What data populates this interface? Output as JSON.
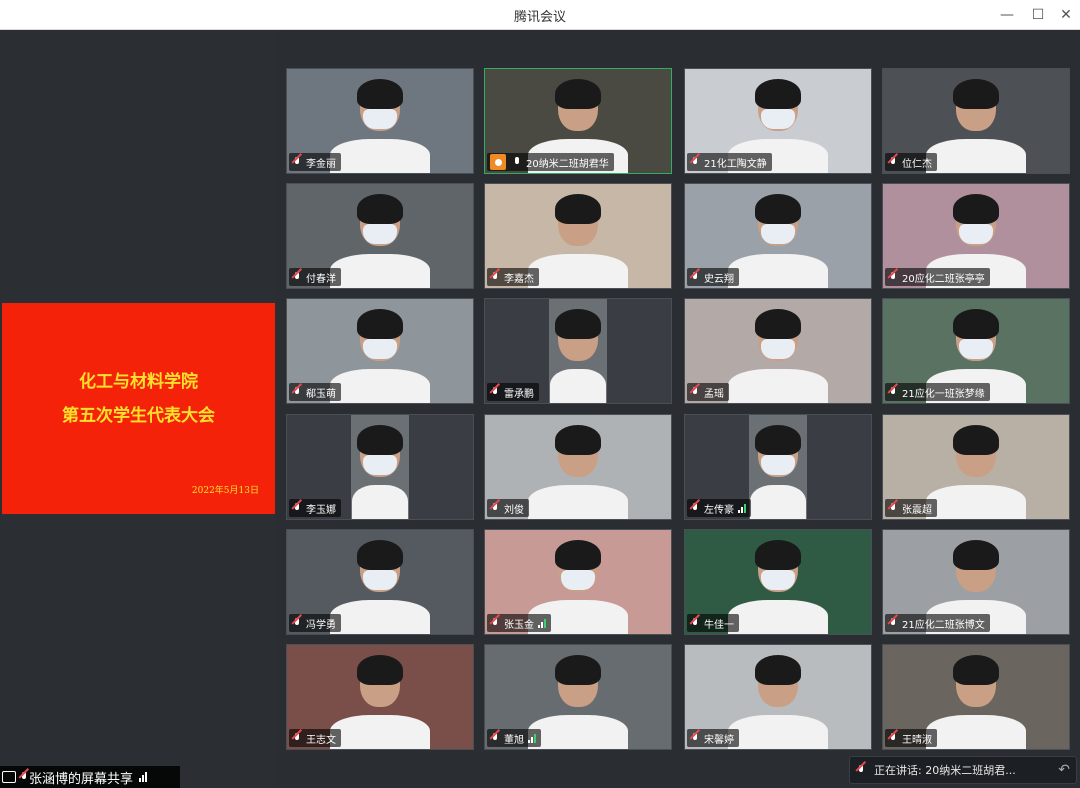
{
  "window": {
    "title": "腾讯会议",
    "minimize": "—",
    "maximize": "☐",
    "close": "✕"
  },
  "slide": {
    "line1": "化工与材料学院",
    "line2": "第五次学生代表大会",
    "date": "2022年5月13日"
  },
  "screen_share": {
    "label": "张涵博的屏幕共享"
  },
  "speaking": {
    "label": "正在讲话: 20纳米二班胡君...",
    "arrow": "↶"
  },
  "participants": [
    {
      "name": "李金丽",
      "bg": "#6e7680",
      "mask": true
    },
    {
      "name": "20纳米二班胡君华",
      "bg": "#4a4a42",
      "mask": false,
      "host": true,
      "mic_on": true,
      "active": true
    },
    {
      "name": "21化工陶文静",
      "bg": "#c9cdd1",
      "mask": true
    },
    {
      "name": "位仁杰",
      "bg": "#4d5055",
      "mask": false
    },
    {
      "name": "付春洋",
      "bg": "#5f6569",
      "mask": true
    },
    {
      "name": "李嘉杰",
      "bg": "#c7b7a6",
      "mask": false
    },
    {
      "name": "史云翔",
      "bg": "#9aa1a8",
      "mask": true
    },
    {
      "name": "20应化二班张亭亭",
      "bg": "#b0909d",
      "mask": true
    },
    {
      "name": "郗玉萌",
      "bg": "#8e969c",
      "mask": true
    },
    {
      "name": "雷承鹏",
      "bg": "#3a3e44",
      "mask": false,
      "narrow": true
    },
    {
      "name": "孟瑶",
      "bg": "#b3a9a6",
      "mask": true
    },
    {
      "name": "21应化一班张梦缘",
      "bg": "#5a7262",
      "mask": true
    },
    {
      "name": "李玉娜",
      "bg": "#3a3e44",
      "mask": true,
      "narrow": true
    },
    {
      "name": "刘俊",
      "bg": "#aeb2b5",
      "mask": false
    },
    {
      "name": "左传豪",
      "bg": "#3a3e44",
      "mask": true,
      "narrow": true,
      "bars": true
    },
    {
      "name": "张震超",
      "bg": "#b8b0a4",
      "mask": false
    },
    {
      "name": "冯学勇",
      "bg": "#545a60",
      "mask": true
    },
    {
      "name": "张玉金",
      "bg": "#c89a95",
      "mask": true,
      "bars": true
    },
    {
      "name": "牛佳一",
      "bg": "#2f5a44",
      "mask": true
    },
    {
      "name": "21应化二班张博文",
      "bg": "#9c9fa3",
      "mask": false
    },
    {
      "name": "王志文",
      "bg": "#7a4f4a",
      "mask": false
    },
    {
      "name": "董旭",
      "bg": "#676c70",
      "mask": false,
      "bars": true
    },
    {
      "name": "宋馨婷",
      "bg": "#b9bcbf",
      "mask": false
    },
    {
      "name": "王晴淑",
      "bg": "#6a655e",
      "mask": false
    }
  ]
}
